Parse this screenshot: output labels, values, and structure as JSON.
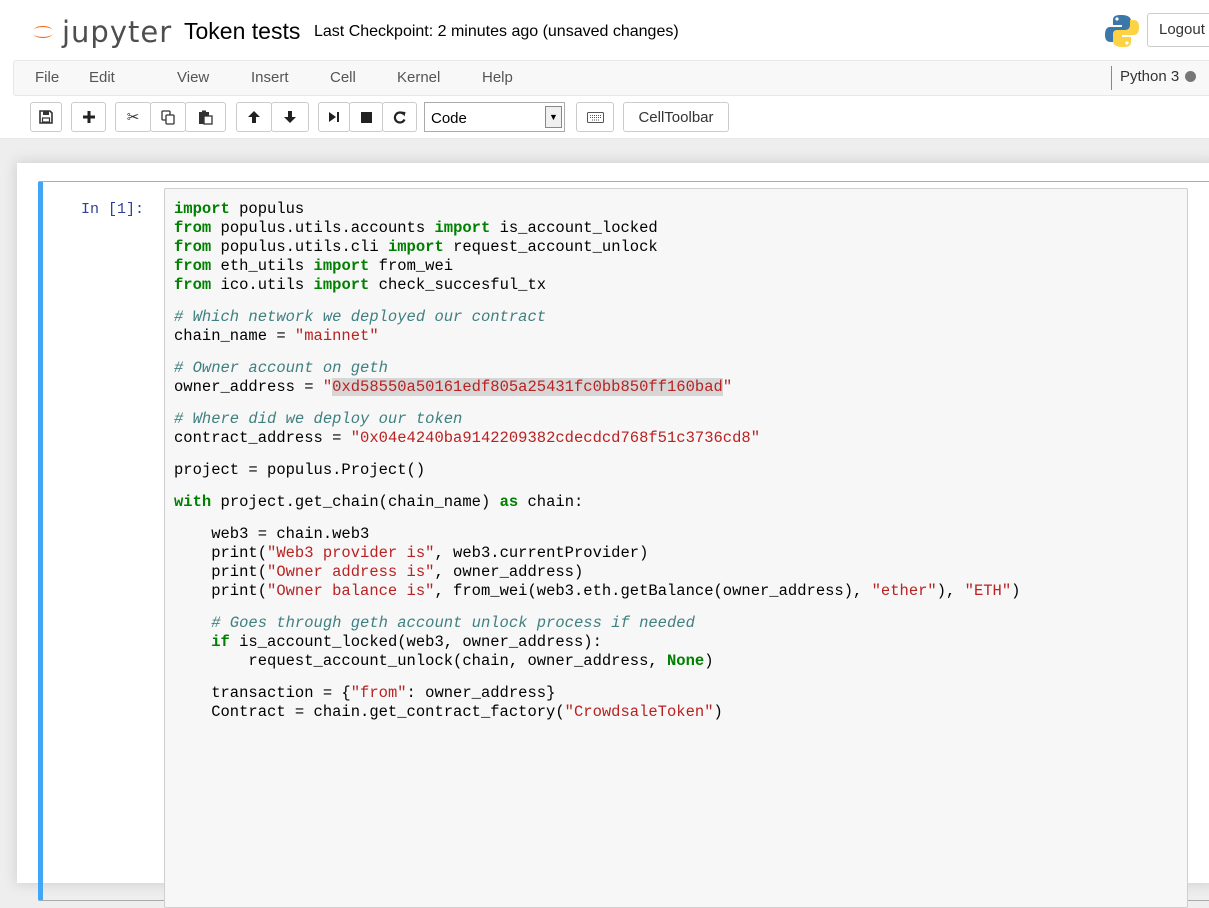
{
  "header": {
    "logo_text": "jupyter",
    "notebook_title": "Token tests",
    "checkpoint_status": "Last Checkpoint: 2 minutes ago (unsaved changes)",
    "logout_label": "Logout"
  },
  "menubar": {
    "items": [
      "File",
      "Edit",
      "View",
      "Insert",
      "Cell",
      "Kernel",
      "Help"
    ],
    "kernel_name": "Python 3"
  },
  "toolbar": {
    "cell_type": "Code",
    "celltoolbar_label": "CellToolbar",
    "icons": [
      "save-icon",
      "add-cell-icon",
      "cut-icon",
      "copy-icon",
      "paste-icon",
      "move-up-icon",
      "move-down-icon",
      "run-icon",
      "stop-icon",
      "restart-icon",
      "keyboard-icon"
    ]
  },
  "cell": {
    "prompt": "In [1]:",
    "code_lines": [
      [
        [
          "kw",
          "import"
        ],
        [
          "t",
          " populus"
        ]
      ],
      [
        [
          "kw",
          "from"
        ],
        [
          "t",
          " populus.utils.accounts "
        ],
        [
          "kw",
          "import"
        ],
        [
          "t",
          " is_account_locked"
        ]
      ],
      [
        [
          "kw",
          "from"
        ],
        [
          "t",
          " populus.utils.cli "
        ],
        [
          "kw",
          "import"
        ],
        [
          "t",
          " request_account_unlock"
        ]
      ],
      [
        [
          "kw",
          "from"
        ],
        [
          "t",
          " eth_utils "
        ],
        [
          "kw",
          "import"
        ],
        [
          "t",
          " from_wei"
        ]
      ],
      [
        [
          "kw",
          "from"
        ],
        [
          "t",
          " ico.utils "
        ],
        [
          "kw",
          "import"
        ],
        [
          "t",
          " check_succesful_tx"
        ]
      ],
      [],
      [
        [
          "com",
          "# Which network we deployed our contract"
        ]
      ],
      [
        [
          "t",
          "chain_name = "
        ],
        [
          "str",
          "\"mainnet\""
        ]
      ],
      [],
      [
        [
          "com",
          "# Owner account on geth"
        ]
      ],
      [
        [
          "t",
          "owner_address = "
        ],
        [
          "str",
          "\""
        ],
        [
          "strhl",
          "0xd58550a50161edf805a25431fc0bb850ff160bad"
        ],
        [
          "str",
          "\""
        ]
      ],
      [],
      [
        [
          "com",
          "# Where did we deploy our token"
        ]
      ],
      [
        [
          "t",
          "contract_address = "
        ],
        [
          "str",
          "\"0x04e4240ba9142209382cdecdcd768f51c3736cd8\""
        ]
      ],
      [],
      [
        [
          "t",
          "project = populus.Project()"
        ]
      ],
      [],
      [
        [
          "kw",
          "with"
        ],
        [
          "t",
          " project.get_chain(chain_name) "
        ],
        [
          "kw",
          "as"
        ],
        [
          "t",
          " chain:"
        ]
      ],
      [],
      [
        [
          "t",
          "    web3 = chain.web3"
        ]
      ],
      [
        [
          "t",
          "    print("
        ],
        [
          "str",
          "\"Web3 provider is\""
        ],
        [
          "t",
          ", web3.currentProvider)"
        ]
      ],
      [
        [
          "t",
          "    print("
        ],
        [
          "str",
          "\"Owner address is\""
        ],
        [
          "t",
          ", owner_address)"
        ]
      ],
      [
        [
          "t",
          "    print("
        ],
        [
          "str",
          "\"Owner balance is\""
        ],
        [
          "t",
          ", from_wei(web3.eth.getBalance(owner_address), "
        ],
        [
          "str",
          "\"ether\""
        ],
        [
          "t",
          "), "
        ],
        [
          "str",
          "\"ETH\""
        ],
        [
          "t",
          ")"
        ]
      ],
      [],
      [
        [
          "com",
          "    # Goes through geth account unlock process if needed"
        ]
      ],
      [
        [
          "t",
          "    "
        ],
        [
          "kw",
          "if"
        ],
        [
          "t",
          " is_account_locked(web3, owner_address):"
        ]
      ],
      [
        [
          "t",
          "        request_account_unlock(chain, owner_address, "
        ],
        [
          "kw",
          "None"
        ],
        [
          "t",
          ")"
        ]
      ],
      [],
      [
        [
          "t",
          "    transaction = {"
        ],
        [
          "str",
          "\"from\""
        ],
        [
          "t",
          ": owner_address}"
        ]
      ],
      [
        [
          "t",
          "    Contract = chain.get_contract_factory("
        ],
        [
          "str",
          "\"CrowdsaleToken\""
        ],
        [
          "t",
          ")"
        ]
      ]
    ]
  }
}
